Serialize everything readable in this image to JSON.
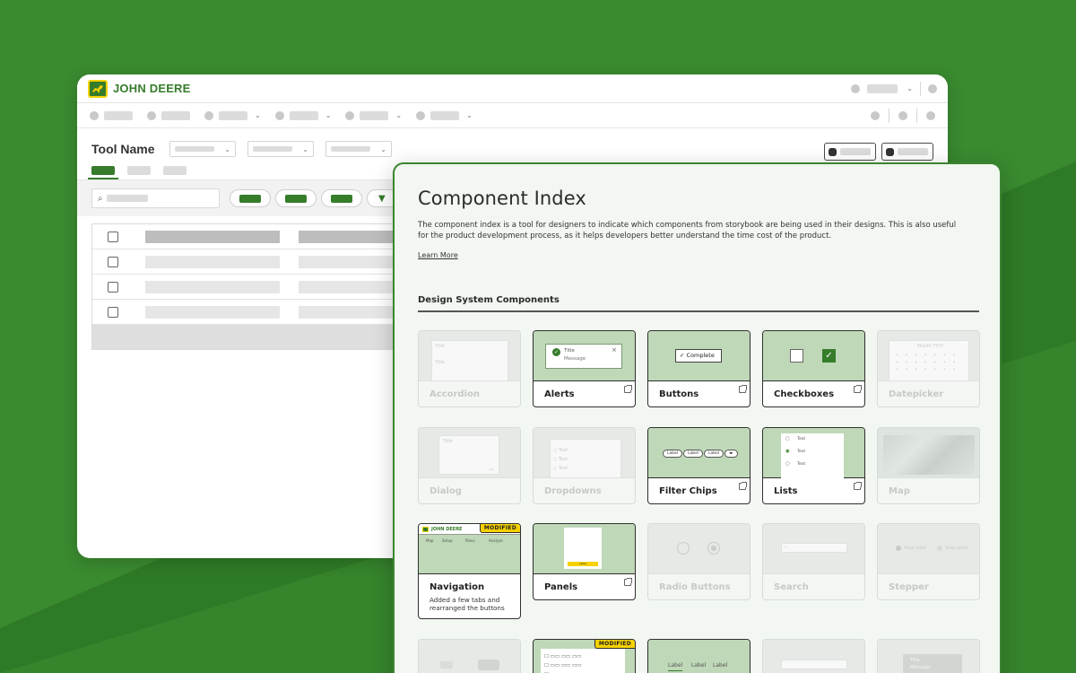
{
  "back_window": {
    "brand_name": "JOHN DEERE",
    "tool_name": "Tool Name"
  },
  "panel": {
    "title": "Component Index",
    "description": "The component index is a tool for designers to indicate which components from storybook are being used in their designs. This is also useful for the product development process, as it helps developers better understand the time cost of the product.",
    "learn_more": "Learn More",
    "section_title": "Design System Components"
  },
  "components": [
    {
      "label": "Accordion",
      "enabled": false
    },
    {
      "label": "Alerts",
      "enabled": true
    },
    {
      "label": "Buttons",
      "enabled": true
    },
    {
      "label": "Checkboxes",
      "enabled": true
    },
    {
      "label": "Datepicker",
      "enabled": false
    },
    {
      "label": "Dialog",
      "enabled": false
    },
    {
      "label": "Dropdowns",
      "enabled": false
    },
    {
      "label": "Filter Chips",
      "enabled": true
    },
    {
      "label": "Lists",
      "enabled": true
    },
    {
      "label": "Map",
      "enabled": false
    },
    {
      "label": "Navigation",
      "enabled": true,
      "badge": "MODIFIED",
      "note": "Added a few tabs and rearranged the buttons"
    },
    {
      "label": "Panels",
      "enabled": true
    },
    {
      "label": "Radio Buttons",
      "enabled": false
    },
    {
      "label": "Search",
      "enabled": false
    },
    {
      "label": "Stepper",
      "enabled": false
    }
  ],
  "previews": {
    "alert_title": "Title",
    "alert_message": "Message",
    "alert_close": "×",
    "button_label": "Complete",
    "chip_label": "Label",
    "list_item": "Text",
    "nav_brand": "JOHN DEERE",
    "nav_tabs": [
      "Map",
      "Setup",
      "Plans",
      "Analyze"
    ],
    "panel_button": "Label",
    "datepicker_month": "Month YYYY",
    "stepper_label": "Step label",
    "lower_badge": "MODIFIED",
    "lower_labels": [
      "Label",
      "Label",
      "Label"
    ],
    "toast_title": "Title",
    "toast_message": "Message"
  },
  "colors": {
    "brand_green": "#367c2b",
    "brand_yellow": "#f5d100",
    "thumb_active": "#bfd8b8",
    "panel_bg": "#f2f7f1",
    "page_bg": "#3a8a30"
  }
}
